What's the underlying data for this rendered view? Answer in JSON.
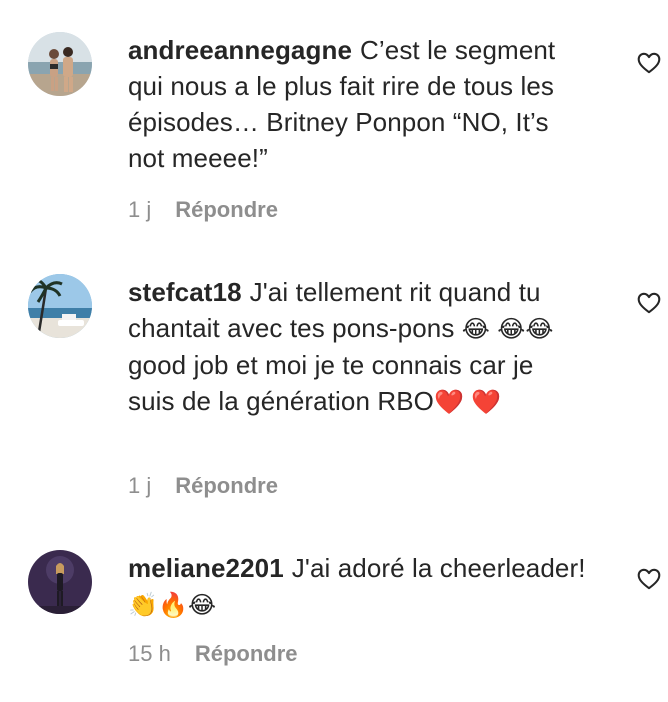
{
  "comments": [
    {
      "username": "andreeannegagne",
      "text": "C’est le segment qui nous a le plus fait rire de tous les épisodes… Britney Ponpon “NO, It’s not meeee!”",
      "time": "1 j",
      "reply_label": "Répondre",
      "avatar_icon": "beach-couple-photo"
    },
    {
      "username": "stefcat18",
      "text_parts": [
        "J'ai tellement rit quand tu chantait avec tes pons-pons ",
        "😂",
        " ",
        "😂😂",
        "good job et moi je te connais car je suis de la génération RBO",
        "❤️",
        " ",
        "❤️"
      ],
      "time": "1 j",
      "reply_label": "Répondre",
      "avatar_icon": "palm-beach-photo"
    },
    {
      "username": "meliane2201",
      "text_parts": [
        "J'ai adoré la cheerleader! ",
        "👏🔥😂"
      ],
      "time": "15 h",
      "reply_label": "Répondre",
      "avatar_icon": "stage-performer-photo"
    }
  ],
  "icons": {
    "like": "heart-outline-icon"
  },
  "colors": {
    "text": "#262626",
    "meta": "#8e8e8e",
    "heart": "#e0172d"
  }
}
